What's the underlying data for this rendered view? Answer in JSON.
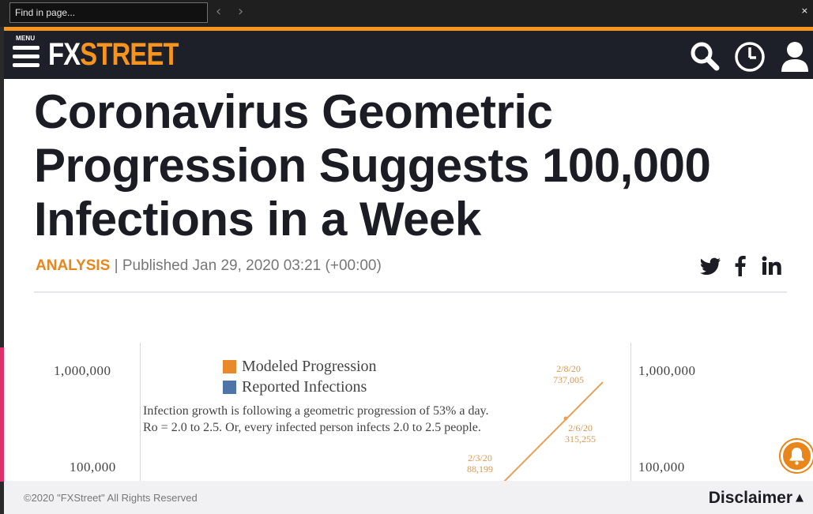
{
  "find_bar": {
    "placeholder": "Find in page...",
    "prev_icon": "chevron-left-icon",
    "next_icon": "chevron-right-icon",
    "close_label": "×"
  },
  "header": {
    "menu_label": "MENU",
    "logo_fx": "FX",
    "logo_street": "STREET",
    "icons": [
      "search-icon",
      "clock-icon",
      "user-icon"
    ],
    "accent_color": "#f7941d",
    "background_color": "#1e2029"
  },
  "article": {
    "title": "Coronavirus Geometric Progression Suggests 100,000 Infections in a Week",
    "category": "ANALYSIS",
    "separator": "|",
    "published": "Published Jan 29, 2020 03:21 (+00:00)",
    "share_icons": [
      "twitter-icon",
      "facebook-icon",
      "linkedin-icon"
    ]
  },
  "chart": {
    "y_labels_left": [
      "1,000,000",
      "100,000"
    ],
    "y_labels_right": [
      "1,000,000",
      "100,000"
    ],
    "legend": [
      {
        "label": "Modeled Progression",
        "color": "#e8892b"
      },
      {
        "label": "Reported Infections",
        "color": "#4f75a8"
      }
    ],
    "note_line1": "Infection growth is following a geometric progression of 53% a day.",
    "note_line2": "Ro = 2.0 to 2.5. Or, every infected person infects 2.0 to 2.5 people.",
    "points": [
      {
        "date": "2/8/20",
        "value": "737,005"
      },
      {
        "date": "2/6/20",
        "value": "315,255"
      },
      {
        "date": "2/3/20",
        "value": "88,199"
      }
    ]
  },
  "footer": {
    "copyright": "©2020 \"FXStreet\" All Rights Reserved",
    "disclaimer": "Disclaimer",
    "disclaimer_caret": "▲"
  },
  "notification_icon": "bell-icon"
}
